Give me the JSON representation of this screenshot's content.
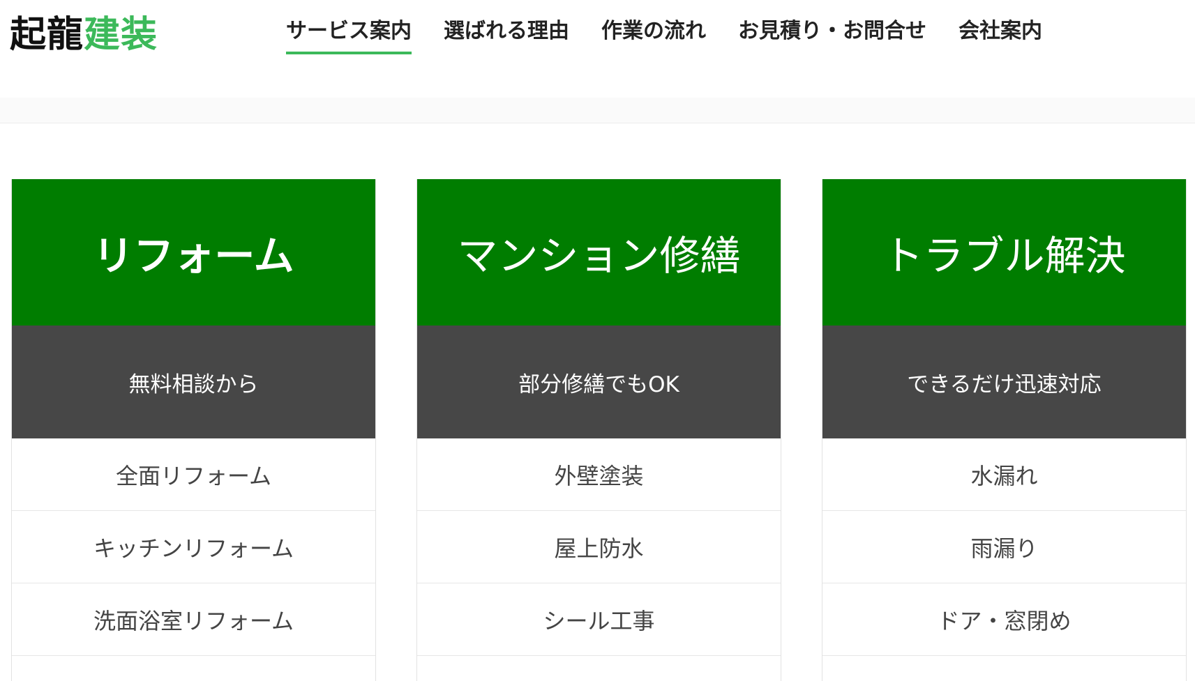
{
  "logo": {
    "part1": "起龍",
    "part2": "建装",
    "colors": {
      "dark": "#111111",
      "accent": "#3cb95a"
    }
  },
  "nav": {
    "items": [
      {
        "label": "サービス案内",
        "active": true
      },
      {
        "label": "選ばれる理由",
        "active": false
      },
      {
        "label": "作業の流れ",
        "active": false
      },
      {
        "label": "お見積り・お問合せ",
        "active": false
      },
      {
        "label": "会社案内",
        "active": false
      }
    ]
  },
  "cards": [
    {
      "title": "リフォーム",
      "subtitle": "無料相談から",
      "items": [
        "全面リフォーム",
        "キッチンリフォーム",
        "洗面浴室リフォーム"
      ]
    },
    {
      "title": "マンション修繕",
      "subtitle": "部分修繕でもOK",
      "items": [
        "外壁塗装",
        "屋上防水",
        "シール工事"
      ]
    },
    {
      "title": "トラブル解決",
      "subtitle": "できるだけ迅速対応",
      "items": [
        "水漏れ",
        "雨漏り",
        "ドア・窓閉め"
      ]
    }
  ],
  "colors": {
    "card_title_bg": "#007d00",
    "card_subtitle_bg": "#474747"
  }
}
